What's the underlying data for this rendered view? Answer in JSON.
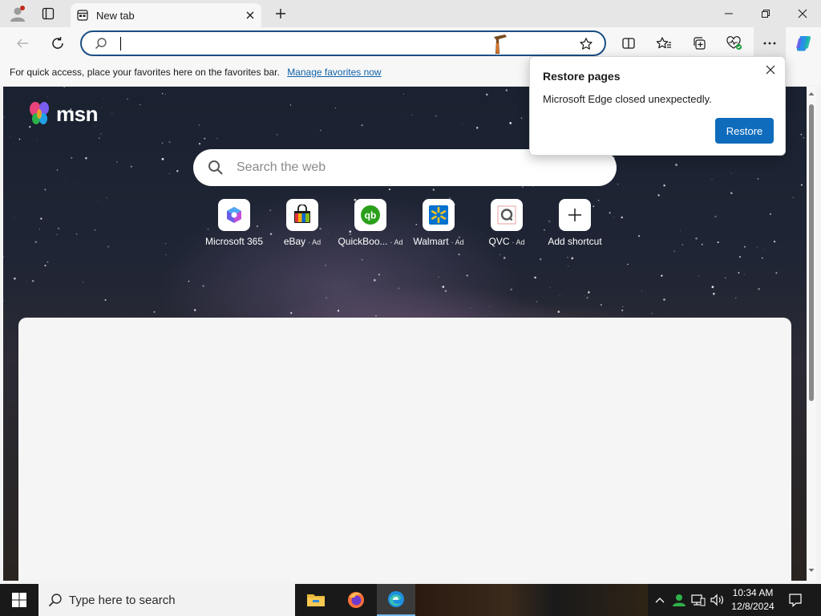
{
  "browser": {
    "tab_title": "New tab",
    "address_value": "",
    "favorites_bar_text": "For quick access, place your favorites here on the favorites bar.",
    "favorites_bar_link": "Manage favorites now"
  },
  "msn": {
    "logo_text": "msn",
    "search_placeholder": "Search the web",
    "shortcuts": [
      {
        "label": "Microsoft 365",
        "ad": "",
        "icon": "microsoft-365-icon"
      },
      {
        "label": "eBay",
        "ad": "Ad",
        "icon": "ebay-icon"
      },
      {
        "label": "QuickBoo...",
        "ad": "Ad",
        "icon": "quickbooks-icon"
      },
      {
        "label": "Walmart",
        "ad": "Ad",
        "icon": "walmart-icon"
      },
      {
        "label": "QVC",
        "ad": "Ad",
        "icon": "qvc-icon"
      },
      {
        "label": "Add shortcut",
        "ad": "",
        "icon": "plus-icon"
      }
    ]
  },
  "popup": {
    "title": "Restore pages",
    "message": "Microsoft Edge closed unexpectedly.",
    "button": "Restore"
  },
  "taskbar": {
    "search_placeholder": "Type here to search",
    "time": "10:34 AM",
    "date": "12/8/2024"
  },
  "colors": {
    "accent": "#0f6cbd",
    "address_border": "#1a4f84",
    "link": "#1062a8"
  }
}
